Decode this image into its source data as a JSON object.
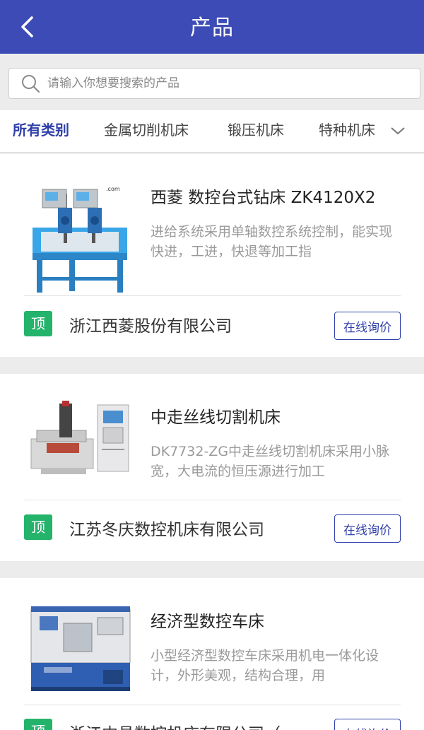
{
  "header": {
    "title": "产品",
    "back_icon": "chevron-left-icon"
  },
  "search": {
    "placeholder": "请输入你想要搜索的产品",
    "icon": "search-icon"
  },
  "tabs": {
    "items": [
      {
        "label": "所有类别",
        "active": true
      },
      {
        "label": "金属切削机床",
        "active": false
      },
      {
        "label": "锻压机床",
        "active": false
      },
      {
        "label": "特种机床",
        "active": false
      }
    ],
    "more_icon": "chevron-down-icon"
  },
  "products": [
    {
      "name": "西菱 数控台式钻床 ZK4120X2",
      "description": "进给系统采用单轴数控系统控制，能实现快进，工进，快退等加工指",
      "badge": "顶",
      "company": "浙江西菱股份有限公司",
      "action": "在线询价"
    },
    {
      "name": "中走丝线切割机床",
      "description": "DK7732-ZG中走丝线切割机床采用小脉宽，大电流的恒压源进行加工",
      "badge": "顶",
      "company": "江苏冬庆数控机床有限公司",
      "action": "在线询价"
    },
    {
      "name": "经济型数控车床",
      "description": "小型经济型数控车床采用机电一体化设计，外形美观，结构合理，用",
      "badge": "顶",
      "company": "浙江中昌数控机床有限公司（",
      "action": "在线询价"
    }
  ],
  "colors": {
    "header": "#3c4bb5",
    "accent": "#2f3fa8",
    "badge": "#24b36b"
  }
}
